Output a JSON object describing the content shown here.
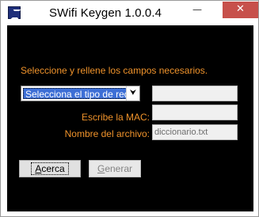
{
  "window": {
    "title": "SWifi Keygen 1.0.0.4",
    "icon": "app-icon",
    "minimize_glyph": "—",
    "maximize_glyph": "☐",
    "close_glyph": "✕"
  },
  "form": {
    "instructions": "Seleccione y rellene los campos necesarios.",
    "network_type_select": {
      "selected": "Selecciona el tipo de red:",
      "arrow_glyph": "⮟"
    },
    "network_field_value": "",
    "mac_label": "Escribe la MAC:",
    "mac_value": "",
    "filename_label": "Nombre del archivo:",
    "filename_value": "diccionario.txt"
  },
  "buttons": {
    "about": {
      "mnemonic": "A",
      "rest": "cerca"
    },
    "generate": {
      "mnemonic": "G",
      "rest": "enerar"
    }
  },
  "colors": {
    "background": "#000000",
    "label_text": "#f0932b",
    "close_button": "#c7504b",
    "selection": "#3d6fd6"
  }
}
